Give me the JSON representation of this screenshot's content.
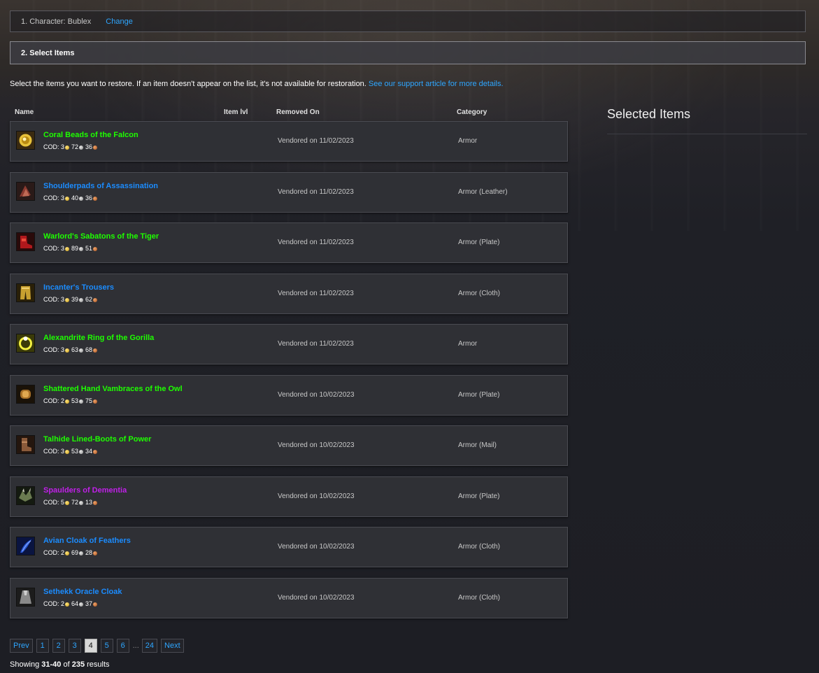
{
  "step1": {
    "label": "1. Character: Bublex",
    "change": "Change"
  },
  "step2": {
    "label": "2. Select Items"
  },
  "intro": {
    "text": "Select the items you want to restore. If an item doesn't appear on the list, it's not available for restoration.",
    "link": "See our support article for more details."
  },
  "headers": {
    "name": "Name",
    "ilvl": "Item lvl",
    "removed": "Removed On",
    "category": "Category"
  },
  "selected": {
    "title": "Selected Items"
  },
  "colors": {
    "uncommon": "#1eff00",
    "rare": "#1b8cff",
    "epic": "#c020e8",
    "link": "#2ea6ff"
  },
  "items": [
    {
      "name": "Coral Beads of the Falcon",
      "quality": "uncommon",
      "icon": "coral-beads-icon",
      "cod_label": "COD:",
      "gold": "3",
      "silver": "72",
      "copper": "36",
      "removed": "Vendored on 11/02/2023",
      "category": "Armor"
    },
    {
      "name": "Shoulderpads of Assassination",
      "quality": "rare",
      "icon": "shoulderpads-icon",
      "cod_label": "COD:",
      "gold": "3",
      "silver": "40",
      "copper": "36",
      "removed": "Vendored on 11/02/2023",
      "category": "Armor (Leather)"
    },
    {
      "name": "Warlord's Sabatons of the Tiger",
      "quality": "uncommon",
      "icon": "sabatons-icon",
      "cod_label": "COD:",
      "gold": "3",
      "silver": "89",
      "copper": "51",
      "removed": "Vendored on 11/02/2023",
      "category": "Armor (Plate)"
    },
    {
      "name": "Incanter's Trousers",
      "quality": "rare",
      "icon": "trousers-icon",
      "cod_label": "COD:",
      "gold": "3",
      "silver": "39",
      "copper": "62",
      "removed": "Vendored on 11/02/2023",
      "category": "Armor (Cloth)"
    },
    {
      "name": "Alexandrite Ring of the Gorilla",
      "quality": "uncommon",
      "icon": "ring-icon",
      "cod_label": "COD:",
      "gold": "3",
      "silver": "63",
      "copper": "68",
      "removed": "Vendored on 11/02/2023",
      "category": "Armor"
    },
    {
      "name": "Shattered Hand Vambraces of the Owl",
      "quality": "uncommon",
      "icon": "vambraces-icon",
      "cod_label": "COD:",
      "gold": "2",
      "silver": "53",
      "copper": "75",
      "removed": "Vendored on 10/02/2023",
      "category": "Armor (Plate)"
    },
    {
      "name": "Talhide Lined-Boots of Power",
      "quality": "uncommon",
      "icon": "boots-icon",
      "cod_label": "COD:",
      "gold": "3",
      "silver": "53",
      "copper": "34",
      "removed": "Vendored on 10/02/2023",
      "category": "Armor (Mail)"
    },
    {
      "name": "Spaulders of Dementia",
      "quality": "epic",
      "icon": "spaulders-icon",
      "cod_label": "COD:",
      "gold": "5",
      "silver": "72",
      "copper": "13",
      "removed": "Vendored on 10/02/2023",
      "category": "Armor (Plate)"
    },
    {
      "name": "Avian Cloak of Feathers",
      "quality": "rare",
      "icon": "feather-cloak-icon",
      "cod_label": "COD:",
      "gold": "2",
      "silver": "69",
      "copper": "28",
      "removed": "Vendored on 10/02/2023",
      "category": "Armor (Cloth)"
    },
    {
      "name": "Sethekk Oracle Cloak",
      "quality": "rare",
      "icon": "cloak-icon",
      "cod_label": "COD:",
      "gold": "2",
      "silver": "64",
      "copper": "37",
      "removed": "Vendored on 10/02/2023",
      "category": "Armor (Cloth)"
    }
  ],
  "pagination": {
    "prev": "Prev",
    "pages": [
      "1",
      "2",
      "3",
      "4",
      "5",
      "6"
    ],
    "current": "4",
    "ellipsis": "...",
    "last": "24",
    "next": "Next"
  },
  "results": {
    "prefix": "Showing ",
    "range": "31-40",
    "mid": " of ",
    "total": "235",
    "suffix": " results"
  }
}
